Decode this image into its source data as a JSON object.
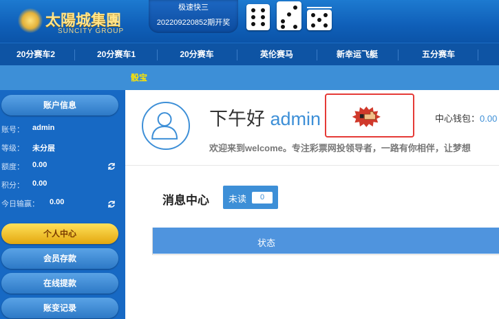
{
  "brand": {
    "title": "太陽城集團",
    "subtitle": "SUNCITY GROUP"
  },
  "lottery": {
    "name": "极速快三",
    "draw": "202209220852期开奖",
    "dice": [
      6,
      3,
      5
    ]
  },
  "nav": {
    "items": [
      "20分赛车2",
      "20分赛车1",
      "20分赛车",
      "英伦赛马",
      "新幸运飞艇",
      "五分赛车"
    ]
  },
  "subnav": {
    "label": "骰宝"
  },
  "sidebar": {
    "account_title": "账户信息",
    "account": {
      "label": "账号：",
      "value": "admin"
    },
    "level": {
      "label": "等级：",
      "value": "未分层"
    },
    "balance": {
      "label": "额度：",
      "value": "0.00"
    },
    "points": {
      "label": "积分：",
      "value": "0.00"
    },
    "today": {
      "label": "今日输赢：",
      "value": "0.00"
    },
    "menu": [
      "个人中心",
      "会员存款",
      "在线提款",
      "账变记录"
    ]
  },
  "main": {
    "greeting": "下午好",
    "username": "admin",
    "wallet_label": "中心钱包：",
    "wallet_value": "0.00",
    "welcome": "欢迎来到welcome。专注彩票网投领导者，一路有你相伴，让梦想"
  },
  "messages": {
    "title": "消息中心",
    "unread_label": "未读",
    "unread_count": "0",
    "columns": [
      "状态"
    ]
  },
  "colors": {
    "header": "#0e54a4",
    "sidebar": "#1769c4",
    "accent": "#3d8fd7",
    "active": "#f5c33a",
    "highlight": "#e53935"
  }
}
